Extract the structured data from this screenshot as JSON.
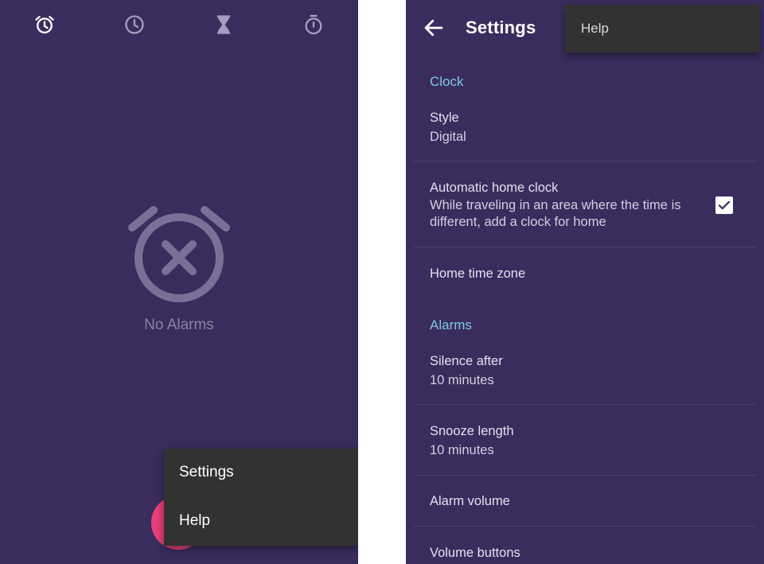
{
  "left_screen": {
    "tabs": [
      {
        "icon": "alarm-icon",
        "selected": true
      },
      {
        "icon": "clock-icon",
        "selected": false
      },
      {
        "icon": "timer-icon",
        "selected": false
      },
      {
        "icon": "stopwatch-icon",
        "selected": false
      }
    ],
    "empty_state": {
      "icon": "alarm-off-icon",
      "label": "No Alarms"
    },
    "overflow_menu": {
      "items": [
        "Settings",
        "Help"
      ]
    },
    "fab": {
      "icon": "add-alarm-icon",
      "color": "#e8407a"
    }
  },
  "right_screen": {
    "toolbar": {
      "back_icon": "arrow-back-icon",
      "title": "Settings"
    },
    "overflow_menu": {
      "items": [
        "Help"
      ]
    },
    "sections": {
      "clock": "Clock",
      "alarms": "Alarms"
    },
    "prefs": {
      "style": {
        "title": "Style",
        "summary": "Digital"
      },
      "auto_home": {
        "title": "Automatic home clock",
        "summary": "While traveling in an area where the time is different, add a clock for home",
        "checked": true
      },
      "home_tz": {
        "title": "Home time zone"
      },
      "silence": {
        "title": "Silence after",
        "summary": "10 minutes"
      },
      "snooze": {
        "title": "Snooze length",
        "summary": "10 minutes"
      },
      "alarm_volume": {
        "title": "Alarm volume"
      },
      "volume_buttons": {
        "title": "Volume buttons"
      }
    }
  },
  "colors": {
    "background": "#3a2d5e",
    "accent": "#7ec6e6",
    "menu": "#323232",
    "fab": "#e8407a"
  }
}
